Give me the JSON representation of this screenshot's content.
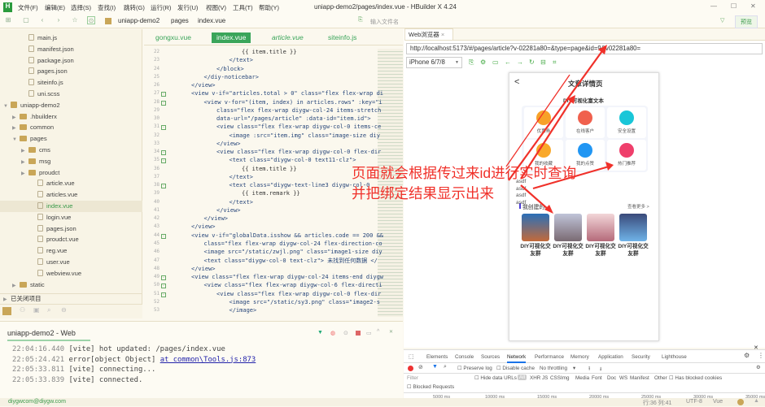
{
  "app": {
    "title": "uniapp-demo2/pages/index.vue - HBuilder X 4.24",
    "menus": [
      "文件(F)",
      "编辑(E)",
      "选择(S)",
      "查找(I)",
      "跳转(G)",
      "运行(R)",
      "发行(U)",
      "视图(V)",
      "工具(T)",
      "帮助(Y)"
    ],
    "window_controls": [
      "—",
      "☐",
      "✕"
    ]
  },
  "toolbar": {
    "breadcrumb": [
      "uniapp-demo2",
      "pages",
      "index.vue"
    ],
    "file_search_placeholder": "输入文件名",
    "preview_label": "预览"
  },
  "sidebar": {
    "items": [
      {
        "label": "main.js",
        "type": "file",
        "depth": 2
      },
      {
        "label": "manifest.json",
        "type": "file",
        "depth": 2
      },
      {
        "label": "package.json",
        "type": "file",
        "depth": 2
      },
      {
        "label": "pages.json",
        "type": "file",
        "depth": 2
      },
      {
        "label": "siteinfo.js",
        "type": "file",
        "depth": 2
      },
      {
        "label": "uni.scss",
        "type": "file",
        "depth": 2
      },
      {
        "label": "uniapp-demo2",
        "type": "project",
        "depth": 0,
        "open": true
      },
      {
        "label": ".hbuilderx",
        "type": "dir",
        "depth": 1
      },
      {
        "label": "common",
        "type": "dir",
        "depth": 1
      },
      {
        "label": "pages",
        "type": "dir",
        "depth": 1,
        "open": true
      },
      {
        "label": "cms",
        "type": "dir",
        "depth": 2
      },
      {
        "label": "msg",
        "type": "dir",
        "depth": 2
      },
      {
        "label": "proudct",
        "type": "dir",
        "depth": 2
      },
      {
        "label": "article.vue",
        "type": "file",
        "depth": 3
      },
      {
        "label": "articles.vue",
        "type": "file",
        "depth": 3
      },
      {
        "label": "index.vue",
        "type": "file",
        "depth": 3,
        "selected": true
      },
      {
        "label": "login.vue",
        "type": "file",
        "depth": 3
      },
      {
        "label": "pages.json",
        "type": "file",
        "depth": 3
      },
      {
        "label": "proudct.vue",
        "type": "file",
        "depth": 3
      },
      {
        "label": "reg.vue",
        "type": "file",
        "depth": 3
      },
      {
        "label": "user.vue",
        "type": "file",
        "depth": 3
      },
      {
        "label": "webview.vue",
        "type": "file",
        "depth": 3
      },
      {
        "label": "static",
        "type": "dir",
        "depth": 1
      }
    ],
    "closed_projects": "已关闭项目"
  },
  "editor": {
    "tabs": [
      {
        "label": "gongxu.vue"
      },
      {
        "label": "index.vue",
        "active": true
      },
      {
        "label": "article.vue",
        "italic": true
      },
      {
        "label": "siteinfo.js"
      }
    ],
    "lines": [
      {
        "n": 22,
        "i": 8,
        "t": "{{ item.title }}"
      },
      {
        "n": 23,
        "i": 7,
        "t": "</text>"
      },
      {
        "n": 24,
        "i": 6,
        "t": "</block>"
      },
      {
        "n": 25,
        "i": 5,
        "t": "</diy-noticebar>"
      },
      {
        "n": 26,
        "i": 4,
        "t": "</view>"
      },
      {
        "n": 27,
        "i": 4,
        "t": "<view v-if=\"articles.total > 0\" class=\"flex flex-wrap di",
        "f": true
      },
      {
        "n": 28,
        "i": 5,
        "t": "<view v-for=\"(item, index) in articles.rows\" :key=\"i",
        "f": true
      },
      {
        "n": 29,
        "i": 6,
        "t": "class=\"flex flex-wrap diygw-col-24 items-stretch"
      },
      {
        "n": 30,
        "i": 6,
        "t": "data-url=\"/pages/article\" :data-id=\"item.id\">"
      },
      {
        "n": 31,
        "i": 6,
        "t": "<view class=\"flex flex-wrap diygw-col-0 items-ce",
        "f": true
      },
      {
        "n": 32,
        "i": 7,
        "t": "<image :src=\"item.img\" class=\"image-size diy"
      },
      {
        "n": 33,
        "i": 6,
        "t": "</view>"
      },
      {
        "n": 34,
        "i": 6,
        "t": "<view class=\"flex flex-wrap diygw-col-0 flex-dir",
        "f": true
      },
      {
        "n": 35,
        "i": 7,
        "t": "<text class=\"diygw-col-0 text11-clz\">",
        "f": true
      },
      {
        "n": 36,
        "i": 8,
        "t": "{{ item.title }}"
      },
      {
        "n": 37,
        "i": 7,
        "t": "</text>"
      },
      {
        "n": 38,
        "i": 7,
        "t": "<text class=\"diygw-text-line3 diygw-col-0",
        "f": true
      },
      {
        "n": 39,
        "i": 8,
        "t": "{{ item.remark }}"
      },
      {
        "n": 40,
        "i": 7,
        "t": "</text>"
      },
      {
        "n": 41,
        "i": 6,
        "t": "</view>"
      },
      {
        "n": 42,
        "i": 5,
        "t": "</view>"
      },
      {
        "n": 43,
        "i": 4,
        "t": "</view>"
      },
      {
        "n": 44,
        "i": 4,
        "t": "<view v-if=\"globalData.isshow && articles.code == 200 &&",
        "f": true
      },
      {
        "n": 45,
        "i": 5,
        "t": "class=\"flex flex-wrap diygw-col-24 flex-direction-co"
      },
      {
        "n": 46,
        "i": 5,
        "t": "<image src=\"/static/zwjl.png\" class=\"image1-size diy"
      },
      {
        "n": 47,
        "i": 5,
        "t": "<text class=\"diygw-col-0 text-clz\"> 未找到任何数据 </"
      },
      {
        "n": 48,
        "i": 4,
        "t": "</view>"
      },
      {
        "n": 49,
        "i": 4,
        "t": "<view class=\"flex flex-wrap diygw-col-24 items-end diygw",
        "f": true
      },
      {
        "n": 50,
        "i": 5,
        "t": "<view class=\"flex flex-wrap diygw-col-6 flex-directi",
        "f": true
      },
      {
        "n": 51,
        "i": 6,
        "t": "<view class=\"flex flex-wrap diygw-col-0 flex-dir",
        "f": true
      },
      {
        "n": 52,
        "i": 7,
        "t": "<image src=\"/static/sy3.png\" class=\"image2-s"
      },
      {
        "n": 53,
        "i": 7,
        "t": "</image>"
      }
    ]
  },
  "console": {
    "tab": "uniapp-demo2 - Web",
    "lines": [
      {
        "time": "22:04:16.440",
        "text": "[vite] hot updated: /pages/index.vue"
      },
      {
        "time": "22:05:24.421",
        "text": "error[object Object] ",
        "link": "at common\\Tools.js:873"
      },
      {
        "time": "22:05:33.811",
        "text": "[vite] connecting..."
      },
      {
        "time": "22:05:33.839",
        "text": "[vite] connected."
      }
    ]
  },
  "status": {
    "user": "diygwcom@diygw.com",
    "position": "行:36  列:41",
    "encoding": "UTF-8",
    "language": "Vue"
  },
  "browser": {
    "tab": "Web浏览器",
    "url": "http://localhost:5173/#/pages/article?v-02281a80=&type=page&id=9&v02281a80=",
    "device": "iPhone 6/7/8"
  },
  "phone": {
    "back": "<",
    "title": "文章详情页",
    "subtitle": "DIY可视化富文本",
    "icons": [
      {
        "label": "优惠券",
        "color": "#f7a128"
      },
      {
        "label": "在线客户",
        "color": "#f0604d"
      },
      {
        "label": "安全设置",
        "color": "#19c6d8"
      },
      {
        "label": "我的收藏",
        "color": "#f9a82a"
      },
      {
        "label": "我的点赞",
        "color": "#2196f3"
      },
      {
        "label": "热门推荐",
        "color": "#ef3f6b"
      }
    ],
    "texts": [
      "asdf",
      "asdf",
      "asdf",
      "asdf"
    ],
    "section_title": "我创建的",
    "more": "查看更多 >",
    "groups": [
      {
        "caption": "DIY可视化交友群"
      },
      {
        "caption": "DIY可视化交友群"
      },
      {
        "caption": "DIY可视化交友群"
      },
      {
        "caption": "DIY可视化交友群"
      }
    ]
  },
  "annotation": {
    "line1": "页面就会根据传过来id进行实时查询",
    "line2": "并把绑定结果显示出来",
    "color": "#f0312a"
  },
  "devtools": {
    "tabs": [
      "Elements",
      "Console",
      "Sources",
      "Network",
      "Performance",
      "Memory",
      "Application",
      "Security",
      "Lighthouse"
    ],
    "active": "Network",
    "preserve_log": "Preserve log",
    "disable_cache": "Disable cache",
    "throttling": "No throttling",
    "filter_placeholder": "Filter",
    "hide_data_urls": "Hide data URLs",
    "all": "All",
    "types": [
      "XHR",
      "JS",
      "CSS",
      "Img",
      "Media",
      "Font",
      "Doc",
      "WS",
      "Manifest",
      "Other"
    ],
    "blocked_cookies": "Has blocked cookies",
    "blocked_requests": "Blocked Requests",
    "timeline": [
      "5000 ms",
      "10000 ms",
      "15000 ms",
      "20000 ms",
      "25000 ms",
      "30000 ms",
      "35000 ms"
    ]
  }
}
